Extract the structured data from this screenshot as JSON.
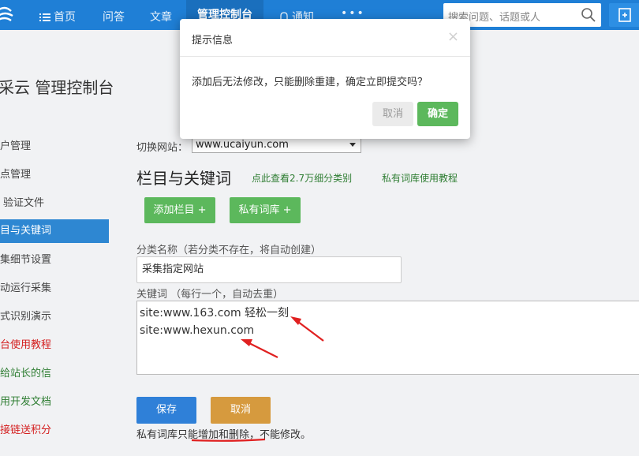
{
  "nav": {
    "items": [
      {
        "label": "首页",
        "icon": "menu-icon"
      },
      {
        "label": "问答"
      },
      {
        "label": "文章"
      },
      {
        "label": "管理控制台",
        "active": true
      },
      {
        "label": "通知",
        "icon": "bell-icon"
      },
      {
        "label": "•••"
      }
    ],
    "search_placeholder": "搜索问题、话题或人"
  },
  "page_title": "采云 管理控制台",
  "sidebar": {
    "items": [
      {
        "label": "户管理"
      },
      {
        "label": "点管理"
      },
      {
        "label": "验证文件"
      },
      {
        "label": "目与关键词",
        "active": true
      },
      {
        "label": "集细节设置"
      },
      {
        "label": "动运行采集"
      },
      {
        "label": "式识别演示"
      },
      {
        "label": "台使用教程",
        "color": "red"
      },
      {
        "label": "给站长的信",
        "color": "green"
      },
      {
        "label": "用开发文档",
        "color": "green"
      },
      {
        "label": "接链送积分",
        "color": "red"
      }
    ]
  },
  "main": {
    "site_label": "切换网站：",
    "site_value": "www.ucaiyun.com",
    "section_title": "栏目与关键词",
    "link_categories": "点此查看2.7万细分类别",
    "link_tutorial": "私有词库使用教程",
    "btn_add_column": "添加栏目 +",
    "btn_private_lib": "私有词库 +",
    "category_label": "分类名称（若分类不存在，将自动创建）",
    "category_value": "采集指定网站",
    "keyword_label": "关键词 （每行一个，自动去重）",
    "keywords": [
      "site:www.163.com 轻松一刻",
      "site:www.hexun.com"
    ],
    "save_label": "保存",
    "cancel_label": "取消",
    "note": "私有词库只能增加和删除，不能修改。"
  },
  "modal": {
    "title": "提示信息",
    "close": "×",
    "body": "添加后无法修改，只能删除重建，确定立即提交吗？",
    "cancel_label": "取消",
    "ok_label": "确定"
  },
  "colors": {
    "nav_blue": "#1f7fd6",
    "green": "#5cb85c",
    "annotation_red": "#e02020"
  }
}
